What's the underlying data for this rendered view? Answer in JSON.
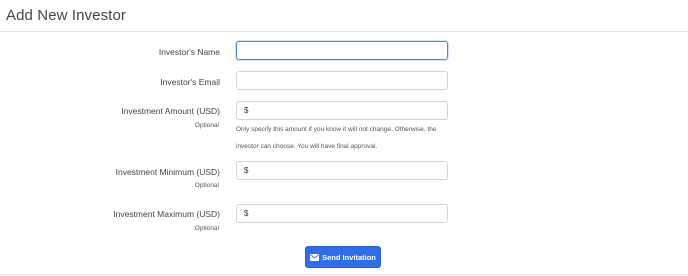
{
  "page": {
    "title": "Add New Investor"
  },
  "form": {
    "name": {
      "label": "Investor's Name",
      "value": ""
    },
    "email": {
      "label": "Investor's Email",
      "value": ""
    },
    "amount": {
      "label": "Investment Amount (USD)",
      "sublabel": "Optional",
      "prefix": "$",
      "help_line1": "Only specify this amount if you know it will not change. Otherwise, the",
      "help_line2": "investor can choose. You will have final approval."
    },
    "minimum": {
      "label": "Investment Minimum (USD)",
      "sublabel": "Optional",
      "prefix": "$"
    },
    "maximum": {
      "label": "Investment Maximum (USD)",
      "sublabel": "Optional",
      "prefix": "$"
    },
    "submit_label": "Send Invitation"
  },
  "icons": {
    "submit": "envelope-icon"
  },
  "colors": {
    "accent": "#2f6ee6",
    "focus": "#4a86e8"
  }
}
